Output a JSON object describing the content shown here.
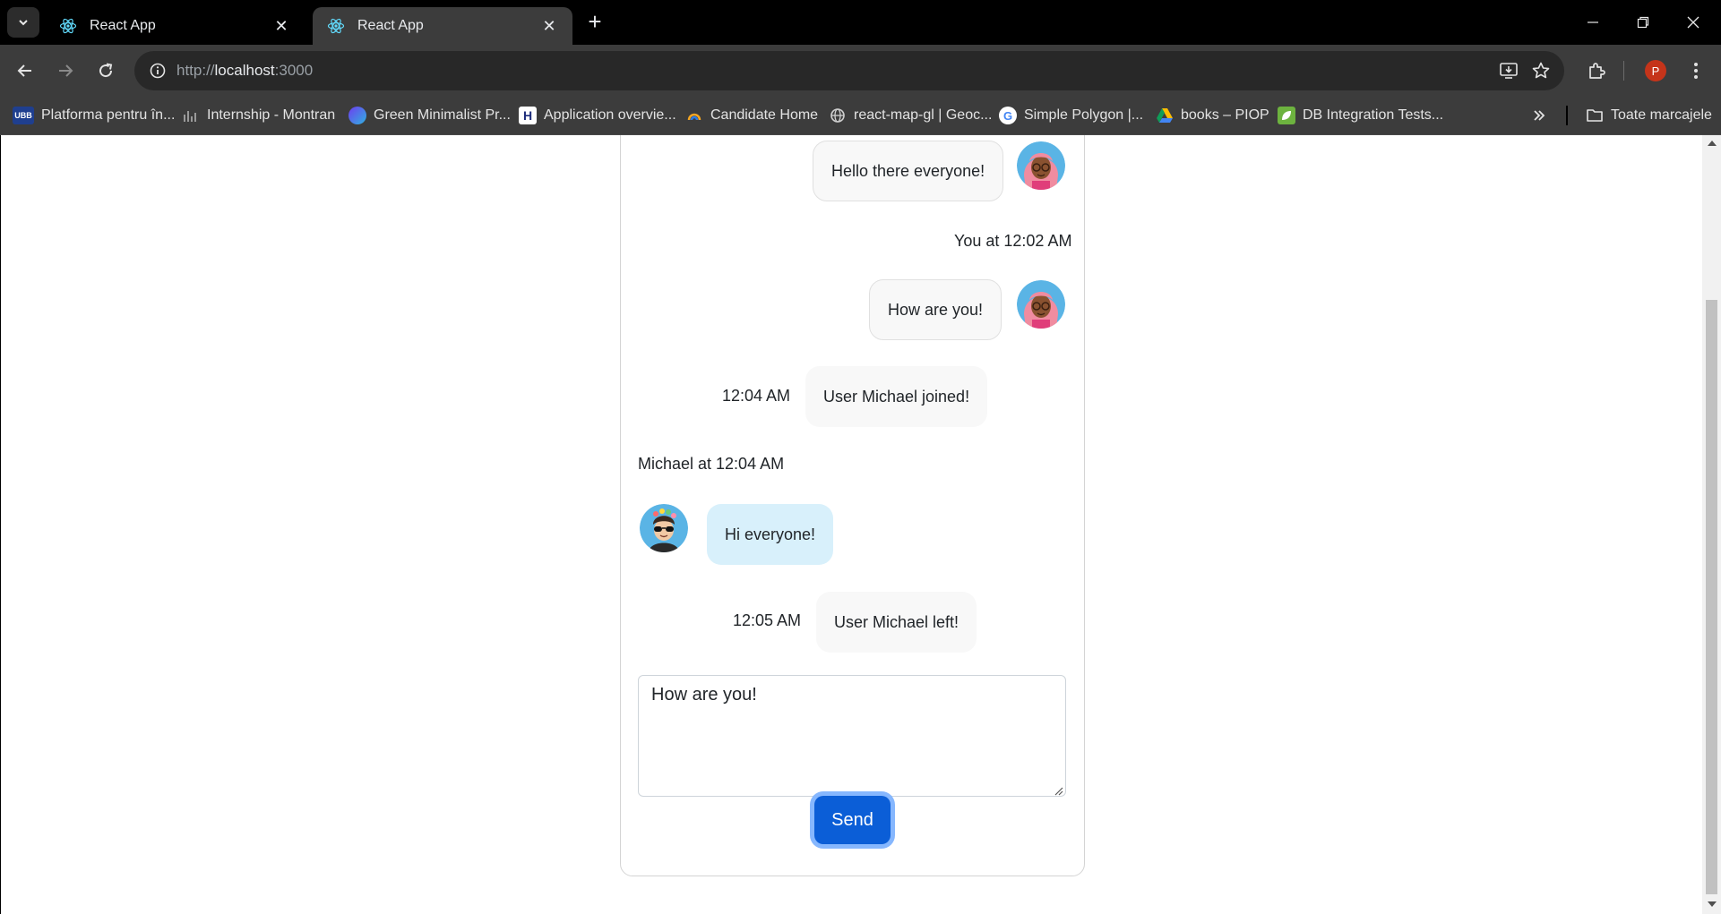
{
  "browser": {
    "tabs": [
      {
        "title": "React App",
        "active": false
      },
      {
        "title": "React App",
        "active": true
      }
    ],
    "url_scheme": "http://",
    "url_host": "localhost",
    "url_port": ":3000",
    "profile_initial": "P",
    "bookmarks": [
      {
        "label": "Platforma pentru în...",
        "icon": "ubb-icon",
        "badge": "UBB"
      },
      {
        "label": "Internship - Montran",
        "icon": "montran-icon"
      },
      {
        "label": "Green Minimalist Pr...",
        "icon": "canva-icon"
      },
      {
        "label": "Application overvie...",
        "icon": "h-icon",
        "badge": "H"
      },
      {
        "label": "Candidate Home",
        "icon": "candidate-icon"
      },
      {
        "label": "react-map-gl | Geoc...",
        "icon": "globe-icon"
      },
      {
        "label": "Simple Polygon  |...",
        "icon": "google-icon",
        "badge": "G"
      },
      {
        "label": "books – PIOP",
        "icon": "drive-icon"
      },
      {
        "label": "DB Integration Tests...",
        "icon": "leaf-icon"
      }
    ],
    "all_bookmarks_label": "Toate marcajele"
  },
  "chat": {
    "messages": [
      {
        "kind": "own",
        "text": "Hello there everyone!"
      },
      {
        "kind": "own-meta",
        "text": "You at 12:02 AM"
      },
      {
        "kind": "own",
        "text": "How are you!"
      },
      {
        "kind": "system",
        "time": "12:04 AM",
        "text": "User Michael joined!"
      },
      {
        "kind": "other-meta",
        "text": "Michael at 12:04 AM"
      },
      {
        "kind": "other",
        "text": "Hi everyone!"
      },
      {
        "kind": "system",
        "time": "12:05 AM",
        "text": "User Michael left!"
      }
    ],
    "composer_value": "How are you!",
    "send_label": "Send"
  },
  "colors": {
    "accent": "#0b5ed7",
    "focus_ring": "#86b7fe",
    "other_bubble": "#d8f0fb",
    "own_bubble": "#f8f8f8"
  }
}
